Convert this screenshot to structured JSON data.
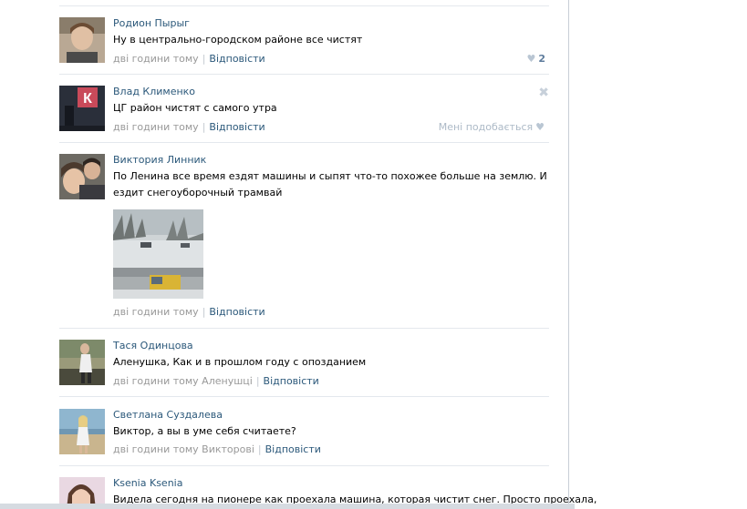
{
  "comments": [
    {
      "author": "Родион Пырыг",
      "text": "Ну в центрально-городском районе все чистят",
      "time": "дві години тому",
      "reply": "Відповісти",
      "likes": "2",
      "avatar_icon": "user-photo"
    },
    {
      "author": "Влад Клименко",
      "text": "ЦГ район чистят с самого утра",
      "time": "дві години тому",
      "reply": "Відповісти",
      "like_label": "Мені подобається",
      "avatar_icon": "user-photo"
    },
    {
      "author": "Виктория Линник",
      "text": "По Ленина все время ездят машины и сыпят что-то похожее больше на землю. И ездит снегоуборочный трамвай",
      "time": "дві години тому",
      "reply": "Відповісти",
      "avatar_icon": "user-photo",
      "photo_icon": "snowy-street-photo"
    },
    {
      "author": "Тася Одинцова",
      "text": "Аленушка, Как и в прошлом году с опозданием",
      "time": "дві години тому Аленушці",
      "reply": "Відповісти",
      "avatar_icon": "user-photo"
    },
    {
      "author": "Светлана Суздалева",
      "text": "Виктор, а вы в уме себя считаете?",
      "time": "дві години тому Викторові",
      "reply": "Відповісти",
      "avatar_icon": "user-photo"
    },
    {
      "author": "Ksenia Ksenia",
      "text": "Видела сегодня на пионере как проехала машина, которая чистит снег. Просто проехала,",
      "avatar_icon": "user-photo"
    }
  ],
  "icons": {
    "like": "heart-icon",
    "close": "close-icon"
  },
  "colors": {
    "link": "#2b587a",
    "muted": "#999999",
    "separator": "#e4e8ed"
  }
}
